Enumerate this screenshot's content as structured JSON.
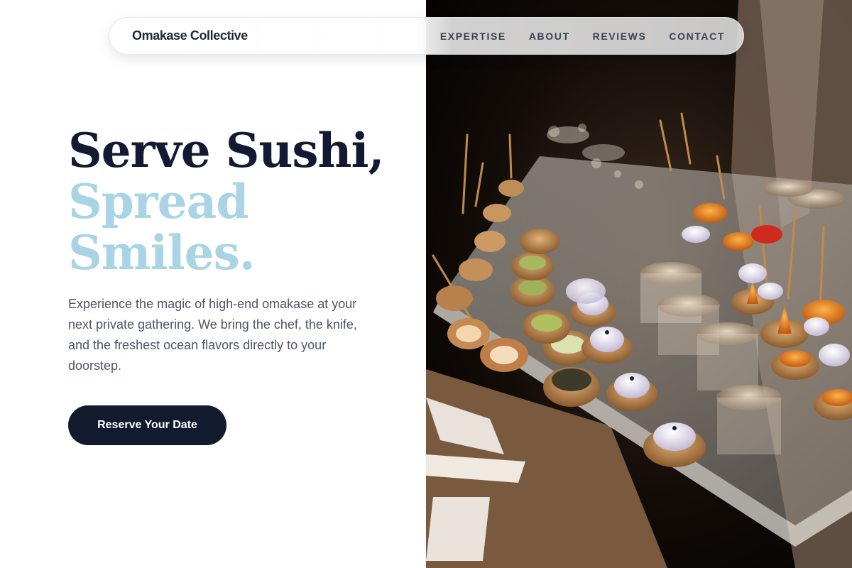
{
  "brand": {
    "name": "Omakase Collective"
  },
  "nav": {
    "links": [
      {
        "label": "EXPERTISE"
      },
      {
        "label": "ABOUT"
      },
      {
        "label": "REVIEWS"
      },
      {
        "label": "CONTACT"
      }
    ]
  },
  "hero": {
    "title_line1": "Serve Sushi,",
    "title_line2": "Spread",
    "title_line3": "Smiles.",
    "description": "Experience the magic of high-end omakase at your next private gathering. We bring the chef, the knife, and the freshest ocean flavors directly to your doorstep.",
    "cta_label": "Reserve Your Date"
  },
  "colors": {
    "title_dark": "#121a33",
    "title_accent": "#a9d4e6",
    "cta_background": "#121a2e",
    "body_text": "#4a5567"
  },
  "image": {
    "subject": "catering tray of canapés and appetizers"
  }
}
